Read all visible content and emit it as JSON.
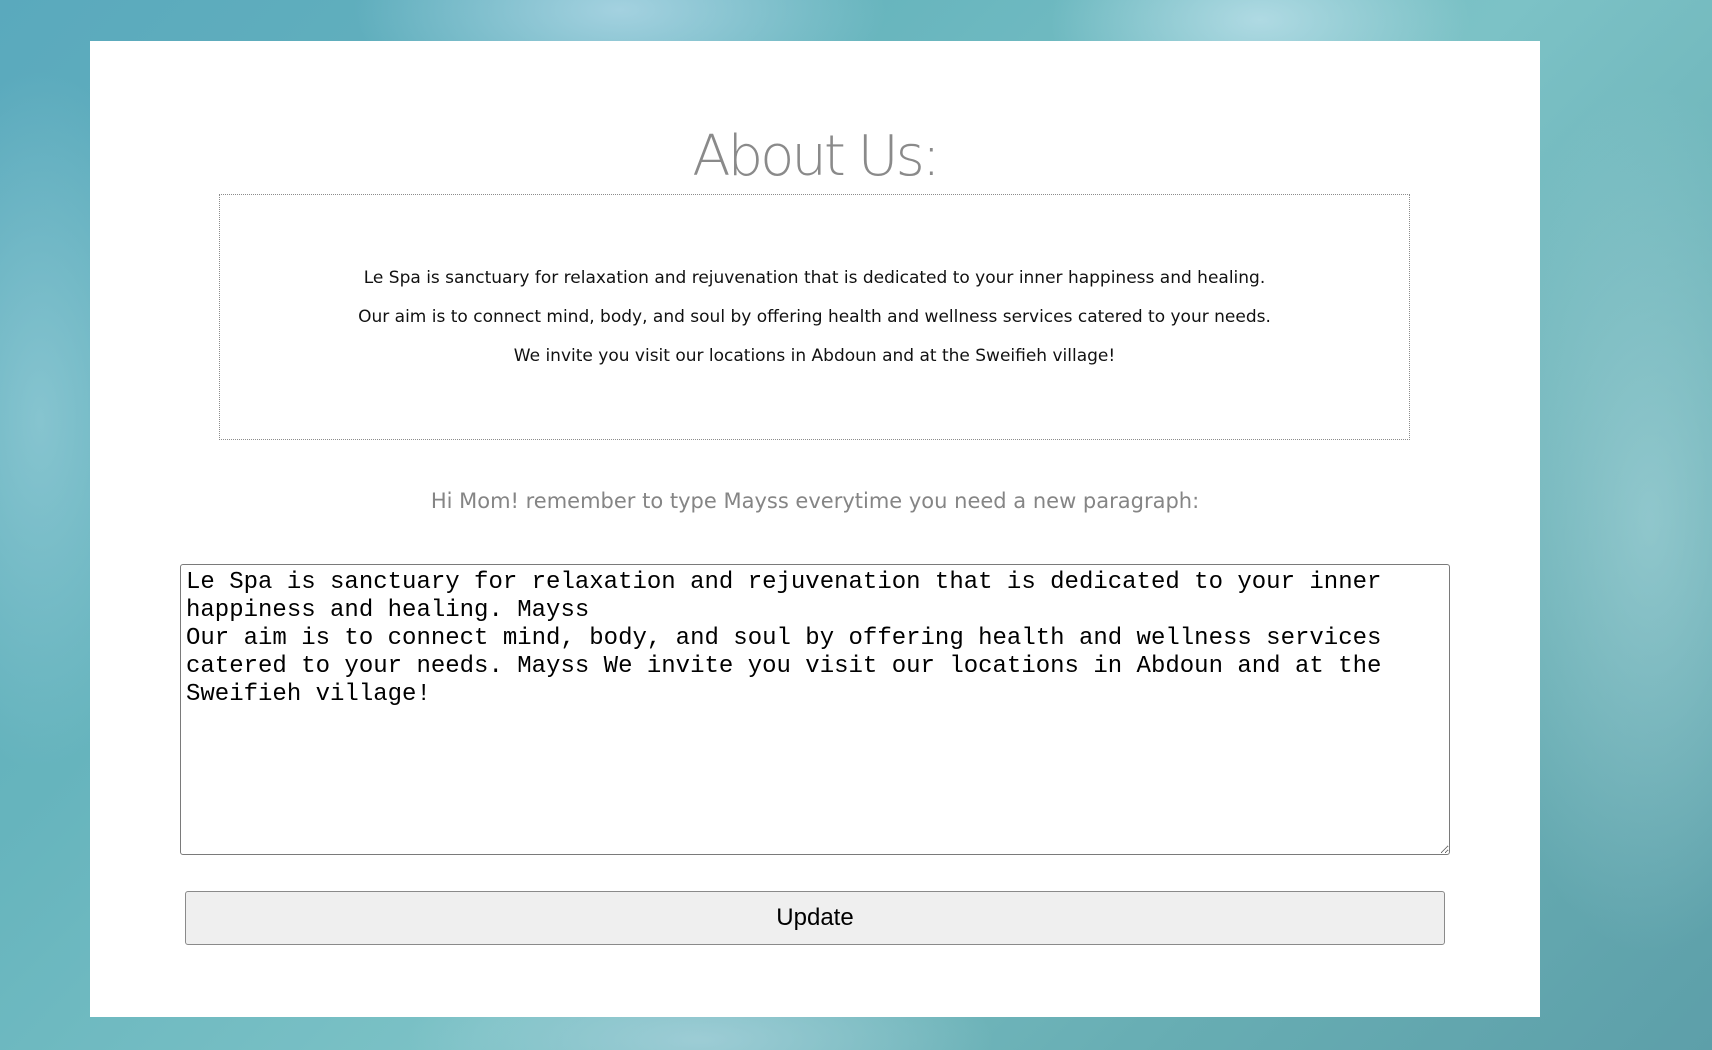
{
  "title": "About Us:",
  "about": {
    "paragraphs": [
      "Le Spa is sanctuary for relaxation and rejuvenation that is dedicated to your inner happiness and healing.",
      "Our aim is to connect mind, body, and soul by offering health and wellness services catered to your needs.",
      "We invite you visit our locations in Abdoun and at the Sweifieh village!"
    ]
  },
  "hint": "Hi Mom! remember to type Mayss everytime you need a new paragraph:",
  "editor": {
    "value": "Le Spa is sanctuary for relaxation and rejuvenation that is dedicated to your inner happiness and healing. Mayss\nOur aim is to connect mind, body, and soul by offering health and wellness services catered to your needs. Mayss We invite you visit our locations in Abdoun and at the Sweifieh village!"
  },
  "update_label": "Update"
}
